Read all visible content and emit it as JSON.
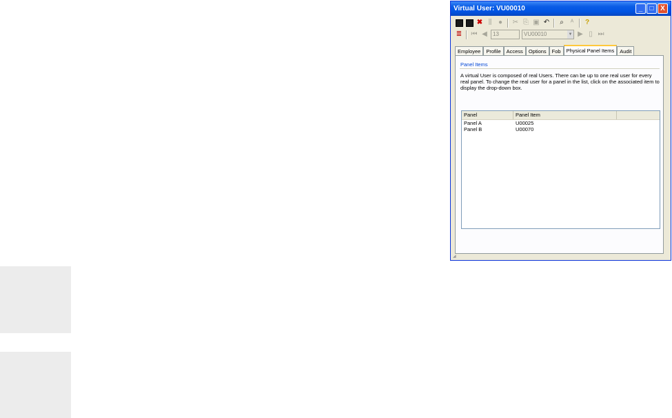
{
  "window": {
    "title": "Virtual User: VU00010",
    "controls": {
      "minimize": "_",
      "maximize": "□",
      "close": "X"
    }
  },
  "toolbar": {
    "record_number": "13",
    "record_select": "VU00010"
  },
  "tabs": [
    "Employee",
    "Profile",
    "Access",
    "Options",
    "Fob",
    "Physical Panel Items",
    "Audit"
  ],
  "active_tab": "Physical Panel Items",
  "group": {
    "title": "Panel Items",
    "description": "A virtual User is composed of real Users. There can be up to one real user for every real panel. To change the real user for a panel in the list, click on the associated item to display the drop-down box."
  },
  "list": {
    "columns": [
      "Panel",
      "Panel Item",
      ""
    ],
    "rows": [
      [
        "Panel A",
        "U00025"
      ],
      [
        "Panel B",
        "U00070"
      ]
    ]
  },
  "colors": {
    "title_bar": "#0054e3",
    "window_bg": "#ece9d8",
    "group_title": "#0046d5"
  }
}
